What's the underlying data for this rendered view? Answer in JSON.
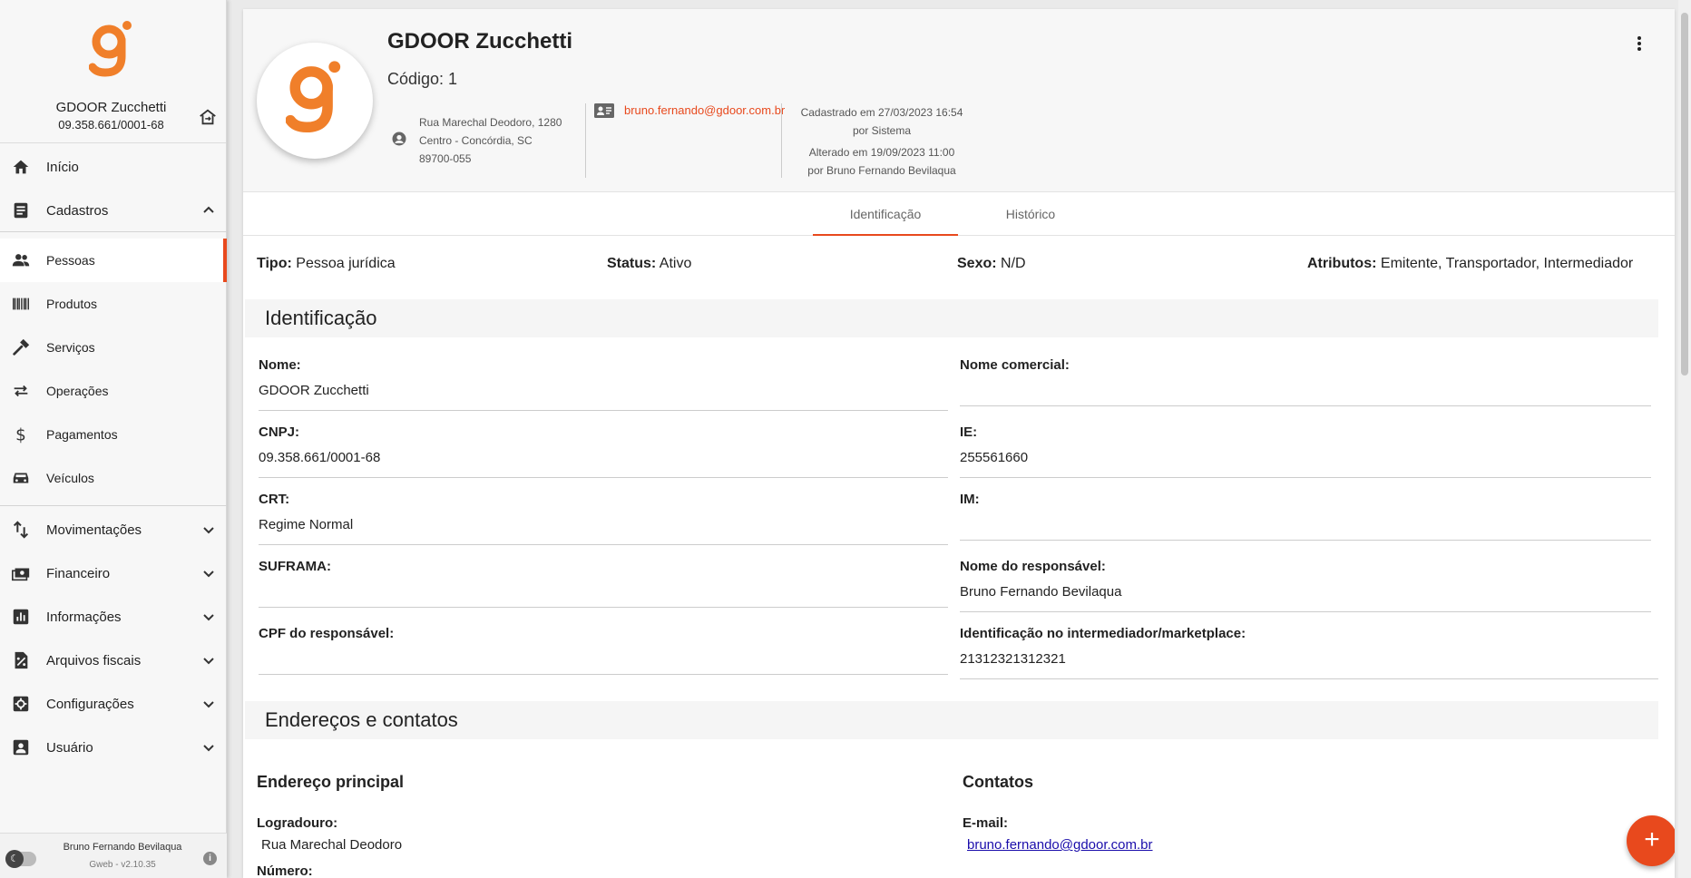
{
  "brand": {
    "name": "GDOOR Zucchetti",
    "cnpj": "09.358.661/0001-68",
    "accent": "#e8491d",
    "logo_orange": "#f07f2a"
  },
  "nav": {
    "inicio": "Início",
    "cadastros": "Cadastros",
    "pessoas": "Pessoas",
    "produtos": "Produtos",
    "servicos": "Serviços",
    "operacoes": "Operações",
    "pagamentos": "Pagamentos",
    "veiculos": "Veículos",
    "movimentacoes": "Movimentações",
    "financeiro": "Financeiro",
    "informacoes": "Informações",
    "arquivos_fiscais": "Arquivos fiscais",
    "configuracoes": "Configurações",
    "usuario": "Usuário"
  },
  "footer": {
    "user": "Bruno Fernando Bevilaqua",
    "version": "Gweb - v2.10.35"
  },
  "header": {
    "title": "GDOOR Zucchetti",
    "code": "Código: 1",
    "address_line1": "Rua Marechal Deodoro, 1280",
    "address_line2": "Centro - Concórdia, SC",
    "address_line3": "89700-055",
    "email": "bruno.fernando@gdoor.com.br",
    "created": "Cadastrado em 27/03/2023 16:54",
    "created_by": "por Sistema",
    "altered": "Alterado em 19/09/2023 11:00",
    "altered_by": "por Bruno Fernando Bevilaqua"
  },
  "tabs": [
    "Identificação",
    "Histórico"
  ],
  "summary": {
    "tipo_label": "Tipo:",
    "tipo_value": "Pessoa jurídica",
    "status_label": "Status:",
    "status_value": "Ativo",
    "sexo_label": "Sexo:",
    "sexo_value": "N/D",
    "atributos_label": "Atributos:",
    "atributos_value": "Emitente, Transportador, Intermediador"
  },
  "identificacao": {
    "title": "Identificação",
    "nome_label": "Nome:",
    "nome_value": "GDOOR Zucchetti",
    "nome_comercial_label": "Nome comercial:",
    "nome_comercial_value": "",
    "cnpj_label": "CNPJ:",
    "cnpj_value": "09.358.661/0001-68",
    "ie_label": "IE:",
    "ie_value": "255561660",
    "crt_label": "CRT:",
    "crt_value": "Regime Normal",
    "im_label": "IM:",
    "im_value": "",
    "suframa_label": "SUFRAMA:",
    "suframa_value": "",
    "responsavel_label": "Nome do responsável:",
    "responsavel_value": "Bruno Fernando Bevilaqua",
    "cpf_resp_label": "CPF do responsável:",
    "cpf_resp_value": "",
    "marketplace_label": "Identificação no intermediador/marketplace:",
    "marketplace_value": "21312321312321"
  },
  "enderecos": {
    "title": "Endereços e contatos",
    "endereco_principal": "Endereço principal",
    "logradouro_label": "Logradouro:",
    "logradouro_value": "Rua Marechal Deodoro",
    "numero_label": "Número:",
    "contatos": "Contatos",
    "email_label": "E-mail:",
    "email_value": "bruno.fernando@gdoor.com.br"
  },
  "fab_label": "+"
}
